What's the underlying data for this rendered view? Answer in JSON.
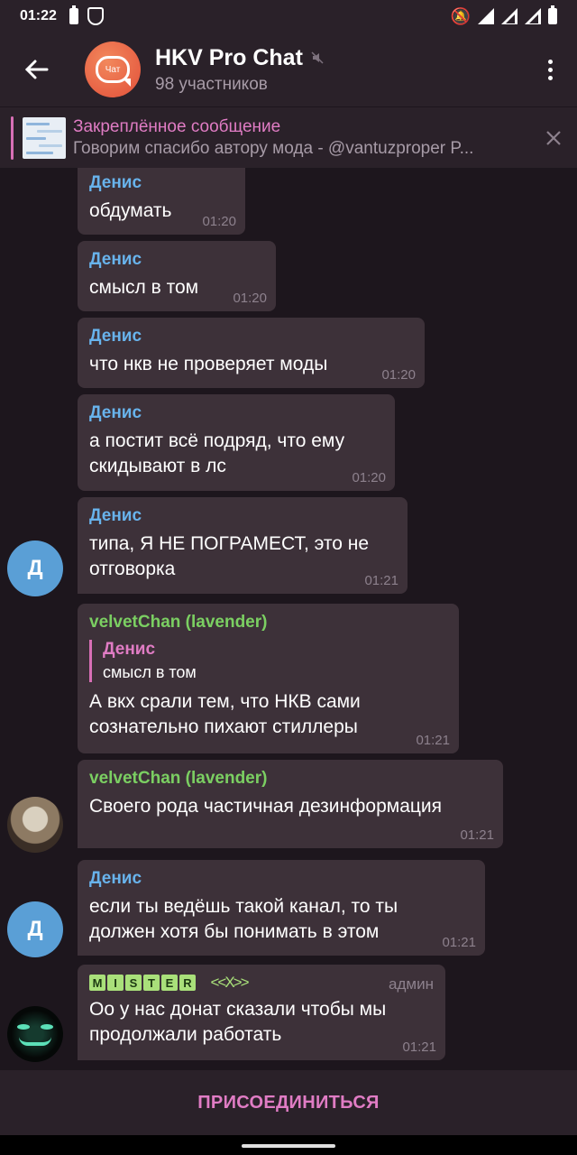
{
  "status_bar": {
    "time": "01:22"
  },
  "header": {
    "title": "HKV Pro Chat",
    "subtitle": "98 участников",
    "avatar_text": "Чат",
    "back_icon": "arrow-left-icon",
    "menu_icon": "more-vertical-icon",
    "mute_icon": "muted-icon"
  },
  "pinned": {
    "title": "Закреплённое сообщение",
    "text": "Говорим спасибо автору мода - @vantuzproper  P..."
  },
  "messages": [
    {
      "sender": "Денис",
      "text": "обдумать",
      "time": "01:20"
    },
    {
      "sender": "Денис",
      "text": "смысл в том",
      "time": "01:20"
    },
    {
      "sender": "Денис",
      "text": "что нкв не проверяет моды",
      "time": "01:20"
    },
    {
      "sender": "Денис",
      "text_line1": "а постит всё подряд, что ему",
      "text_line2": "скидывают в лс",
      "time": "01:20"
    },
    {
      "sender": "Денис",
      "text_line1": "типа, Я НЕ ПОГРАМЕСТ, это не",
      "text_line2": "отговорка",
      "time": "01:21",
      "avatar_letter": "Д"
    },
    {
      "sender": "velvetChan (lavender)",
      "reply_sender": "Денис",
      "reply_text": "смысл в том",
      "text_line1": "А вкх срали тем, что НКВ сами",
      "text_line2": "сознательно пихают стиллеры",
      "time": "01:21"
    },
    {
      "sender": "velvetChan (lavender)",
      "text": "Своего рода частичная дезинформация",
      "time": "01:21"
    },
    {
      "sender": "Денис",
      "text_line1": "если ты ведёшь такой канал, то ты",
      "text_line2": "должен хотя бы понимать в этом",
      "time": "01:21",
      "avatar_letter": "Д"
    },
    {
      "sender_letters": [
        "M",
        "I",
        "S",
        "T",
        "E",
        "R"
      ],
      "sender_suffix": "<<X>>",
      "role": "админ",
      "text_line1": "Оо у нас донат сказали чтобы мы",
      "text_line2": "продолжали работать",
      "time": "01:21"
    }
  ],
  "join_button": "ПРИСОЕДИНИТЬСЯ",
  "colors": {
    "background": "#1d161d",
    "bar": "#2a2129",
    "bubble": "#3d3139",
    "accent_pink": "#e07cc4",
    "name_blue": "#68b3ec",
    "name_green": "#7bcf62"
  }
}
